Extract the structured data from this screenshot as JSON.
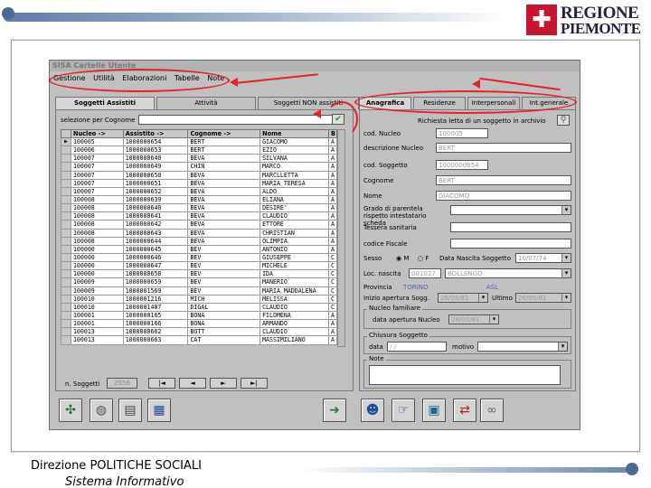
{
  "org": {
    "name_line1": "REGIONE",
    "name_line2": "PIEMONTE",
    "emblem": "piemonte-cross-shield",
    "brand_red": "#c8142e"
  },
  "footer": {
    "department": "Direzione POLITICHE SOCIALI",
    "system": "Sistema Informativo"
  },
  "app": {
    "title": "SISA Cartelle Utente",
    "menu": [
      "Gestione",
      "Utilità",
      "Elaborazioni",
      "Tabelle",
      "Note"
    ],
    "left_tabs": [
      "Soggetti Assistiti",
      "Attività",
      "Soggetti NON assistiti"
    ],
    "search": {
      "label": "selezione per Cognome",
      "value": "",
      "ok_icon": "checkmark-icon"
    },
    "grid": {
      "columns": [
        "Nucleo ->",
        "Assistito ->",
        "Cognome ->",
        "Nome",
        "B"
      ],
      "rows": [
        [
          "100005",
          "1000000654",
          "BERT",
          "GIACOMO",
          "A"
        ],
        [
          "100006",
          "1000000653",
          "BERT",
          "EZIO",
          "A"
        ],
        [
          "100007",
          "1000000640",
          "BEVA",
          "SILVANA",
          "A"
        ],
        [
          "100007",
          "1000000649",
          "CHIN",
          "MARCO",
          "A"
        ],
        [
          "100007",
          "1000000650",
          "BEVA",
          "MARCLLETTA",
          "A"
        ],
        [
          "100007",
          "1000000651",
          "BEVA",
          "MARIA TERESA",
          "A"
        ],
        [
          "100007",
          "1000000652",
          "BEVA",
          "ALDO",
          "A"
        ],
        [
          "100008",
          "1000000639",
          "BEVA",
          "ELIANA",
          "A"
        ],
        [
          "100008",
          "1000000640",
          "BEVA",
          "DESIRE'",
          "A"
        ],
        [
          "100008",
          "1000000641",
          "BEVA",
          "CLAUDIO",
          "A"
        ],
        [
          "100008",
          "1000000642",
          "BEVA",
          "ETTORE",
          "A"
        ],
        [
          "100008",
          "1000000643",
          "BEVA",
          "CHRISTIAN",
          "A"
        ],
        [
          "100008",
          "1000000644",
          "BEVA",
          "OLIMPIA",
          "A"
        ],
        [
          "100000",
          "1000000645",
          "BEV",
          "ANTONIO",
          "A"
        ],
        [
          "100000",
          "1000000646",
          "BEV",
          "GIUSEPPE",
          "C"
        ],
        [
          "100000",
          "1000000647",
          "BEV",
          "MICHELE",
          "C"
        ],
        [
          "100000",
          "1000000658",
          "BEV",
          "IDA",
          "C"
        ],
        [
          "100009",
          "1000000659",
          "BEV",
          "MANERIO",
          "C"
        ],
        [
          "100009",
          "1000001569",
          "BEV",
          "MARIA MADDALENA",
          "C"
        ],
        [
          "100010",
          "1000001216",
          "MICH",
          "MELISSA",
          "C"
        ],
        [
          "100010",
          "1000001407",
          "DIGAL",
          "CLAUDIO",
          "C"
        ],
        [
          "100001",
          "1000000165",
          "BONA",
          "FILOMENA",
          "A"
        ],
        [
          "100001",
          "1000000166",
          "BONA",
          "ARMANDO",
          "A"
        ],
        [
          "100013",
          "1000000662",
          "BOTT",
          "CLAUDIO",
          "A"
        ],
        [
          "100013",
          "1000000663",
          "CAT",
          "MASSIMILIANO",
          "A"
        ]
      ]
    },
    "count": {
      "label": "n. Soggetti",
      "value": "2556"
    },
    "nav": [
      "|◄",
      "◄",
      "►",
      "►|"
    ],
    "right_tabs": [
      "Anagrafica",
      "Residenze",
      "Interpersonali",
      "Int.generale"
    ],
    "record_lookup": {
      "label": "Richiesta letta di un soggetto in archivio",
      "icon": "lookup-icon"
    },
    "fields": {
      "cod_nucleo": {
        "label": "cod. Nucleo",
        "value": "100005"
      },
      "descrizione_nucleo": {
        "label": "descrizione Nucleo",
        "value": "BERT"
      },
      "cod_soggetto": {
        "label": "cod. Soggetto",
        "value": "1000000654"
      },
      "cognome": {
        "label": "Cognome",
        "value": "BERT"
      },
      "nome": {
        "label": "Nome",
        "value": "GIACOMO"
      },
      "grado_parentela": {
        "label": "Grado di parentela rispetto intestatario scheda",
        "value": ""
      },
      "tessera_sanitaria": {
        "label": "Tessera sanitaria",
        "value": ""
      },
      "codice_fiscale": {
        "label": "codice Fiscale",
        "value": ""
      },
      "sesso": {
        "label": "Sesso",
        "options": [
          "M",
          "F"
        ],
        "selected": "M"
      },
      "data_nascita": {
        "label": "Data Nascita Soggetto",
        "value": "10/07/74"
      },
      "loc_nascita": {
        "label": "Loc. nascita",
        "code": "001027",
        "name": "BOLLENGO"
      },
      "provincia": {
        "label": "Provincia",
        "value": "TORINO",
        "asl_label": "ASL"
      },
      "inizio": {
        "label": "Inizio apertura Sogg.",
        "value": "26/05/81",
        "ultimo_label": "Ultimo",
        "ultimo_value": "26/05/81"
      },
      "nucleo_group": {
        "title": "Nucleo familiare",
        "label": "data apertura Nucleo",
        "value": "26/05/81"
      },
      "chiusura_group": {
        "title": "Chiusura Soggetto",
        "data_label": "data",
        "data_value": "/  /",
        "motivo_label": "motivo",
        "motivo_value": ""
      },
      "note_group": {
        "title": "Note",
        "value": ""
      }
    },
    "toolbar_left": [
      "puzzle-icon",
      "globe-icon",
      "printer-icon",
      "chart-icon"
    ],
    "toolbar_exit": "exit-door-icon",
    "toolbar_right": [
      "user-card-icon",
      "hand-document-icon",
      "folder-transfer-icon",
      "link-icon",
      "search-binoculars-icon"
    ],
    "annotation_color": "#e6222e"
  }
}
